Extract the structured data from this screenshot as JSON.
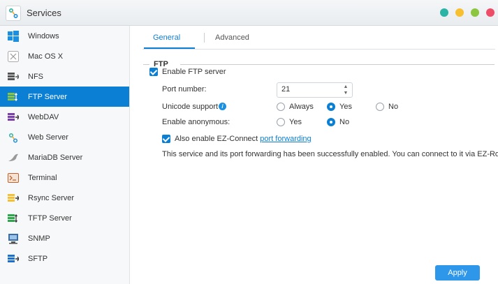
{
  "window": {
    "title": "Services"
  },
  "window_controls": {
    "colors": [
      "#2bb3a6",
      "#f7c033",
      "#8cc63f",
      "#ee4d67"
    ]
  },
  "sidebar": {
    "items": [
      {
        "label": "Windows",
        "icon": "windows-icon"
      },
      {
        "label": "Mac OS X",
        "icon": "macos-icon"
      },
      {
        "label": "NFS",
        "icon": "nfs-icon"
      },
      {
        "label": "FTP Server",
        "icon": "ftp-icon",
        "active": true
      },
      {
        "label": "WebDAV",
        "icon": "webdav-icon"
      },
      {
        "label": "Web Server",
        "icon": "web-server-icon"
      },
      {
        "label": "MariaDB Server",
        "icon": "mariadb-icon"
      },
      {
        "label": "Terminal",
        "icon": "terminal-icon"
      },
      {
        "label": "Rsync Server",
        "icon": "rsync-icon"
      },
      {
        "label": "TFTP Server",
        "icon": "tftp-icon"
      },
      {
        "label": "SNMP",
        "icon": "snmp-icon"
      },
      {
        "label": "SFTP",
        "icon": "sftp-icon"
      }
    ]
  },
  "tabs": {
    "general": "General",
    "advanced": "Advanced",
    "active": "General"
  },
  "ftp": {
    "section_title": "FTP",
    "enable_label": "Enable FTP server",
    "enable_checked": true,
    "port_label": "Port number:",
    "port_value": "21",
    "unicode_label": "Unicode support",
    "unicode_options": {
      "always": "Always",
      "yes": "Yes",
      "no": "No"
    },
    "unicode_selected": "Yes",
    "anonymous_label": "Enable anonymous:",
    "anonymous_options": {
      "yes": "Yes",
      "no": "No"
    },
    "anonymous_selected": "No",
    "ezconnect_label": "Also enable EZ-Connect",
    "ezconnect_link": "port forwarding",
    "ezconnect_checked": true,
    "status_message": "This service and its port forwarding has been successfully enabled. You can connect to it via EZ-Router"
  },
  "apply_label": "Apply",
  "accent_color": "#0b7fd4"
}
